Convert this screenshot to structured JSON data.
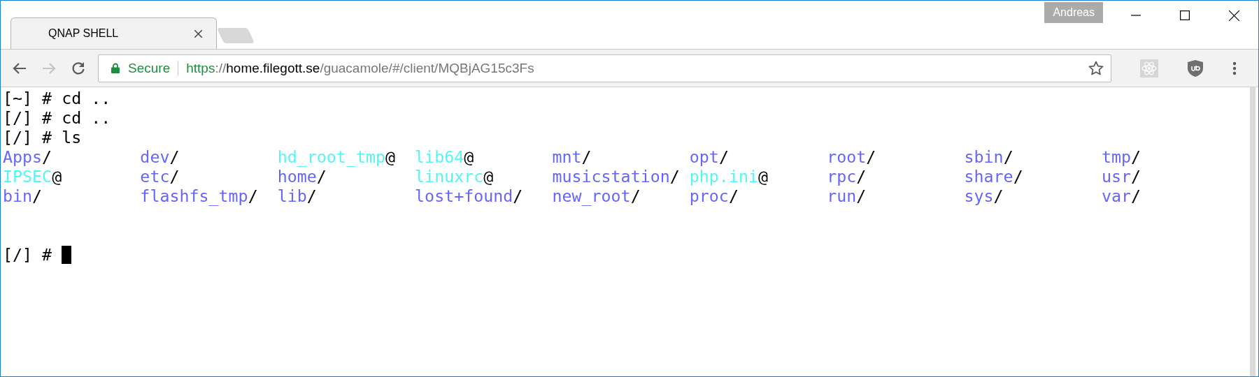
{
  "window": {
    "tabs": [
      {
        "title": "QNAP SHELL",
        "selected": true
      }
    ],
    "profile": "Andreas"
  },
  "address_bar": {
    "security": "Secure",
    "scheme": "https",
    "separator": "://",
    "host": "home.filegott.se",
    "path": "/guacamole/#/client/MQBjAG15c3Fs"
  },
  "terminal": {
    "lines": [
      "[~] # cd ..",
      "[/] # cd ..",
      "[/] # ls"
    ],
    "listing": [
      [
        {
          "name": "Apps",
          "suffix": "/",
          "kind": "dir"
        },
        {
          "name": "dev",
          "suffix": "/",
          "kind": "dir"
        },
        {
          "name": "hd_root_tmp",
          "suffix": "@",
          "kind": "link"
        },
        {
          "name": "lib64",
          "suffix": "@",
          "kind": "link"
        },
        {
          "name": "mnt",
          "suffix": "/",
          "kind": "dir"
        },
        {
          "name": "opt",
          "suffix": "/",
          "kind": "dir"
        },
        {
          "name": "root",
          "suffix": "/",
          "kind": "dir"
        },
        {
          "name": "sbin",
          "suffix": "/",
          "kind": "dir"
        },
        {
          "name": "tmp",
          "suffix": "/",
          "kind": "dir"
        }
      ],
      [
        {
          "name": "IPSEC",
          "suffix": "@",
          "kind": "link"
        },
        {
          "name": "etc",
          "suffix": "/",
          "kind": "dir"
        },
        {
          "name": "home",
          "suffix": "/",
          "kind": "dir"
        },
        {
          "name": "linuxrc",
          "suffix": "@",
          "kind": "link"
        },
        {
          "name": "musicstation",
          "suffix": "/",
          "kind": "dir"
        },
        {
          "name": "php.ini",
          "suffix": "@",
          "kind": "link"
        },
        {
          "name": "rpc",
          "suffix": "/",
          "kind": "dir"
        },
        {
          "name": "share",
          "suffix": "/",
          "kind": "dir"
        },
        {
          "name": "usr",
          "suffix": "/",
          "kind": "dir"
        }
      ],
      [
        {
          "name": "bin",
          "suffix": "/",
          "kind": "dir"
        },
        {
          "name": "flashfs_tmp",
          "suffix": "/",
          "kind": "dir"
        },
        {
          "name": "lib",
          "suffix": "/",
          "kind": "dir"
        },
        {
          "name": "lost+found",
          "suffix": "/",
          "kind": "dir"
        },
        {
          "name": "new_root",
          "suffix": "/",
          "kind": "dir"
        },
        {
          "name": "proc",
          "suffix": "/",
          "kind": "dir"
        },
        {
          "name": "run",
          "suffix": "/",
          "kind": "dir"
        },
        {
          "name": "sys",
          "suffix": "/",
          "kind": "dir"
        },
        {
          "name": "var",
          "suffix": "/",
          "kind": "dir"
        }
      ]
    ],
    "prompt": "[/] #"
  }
}
